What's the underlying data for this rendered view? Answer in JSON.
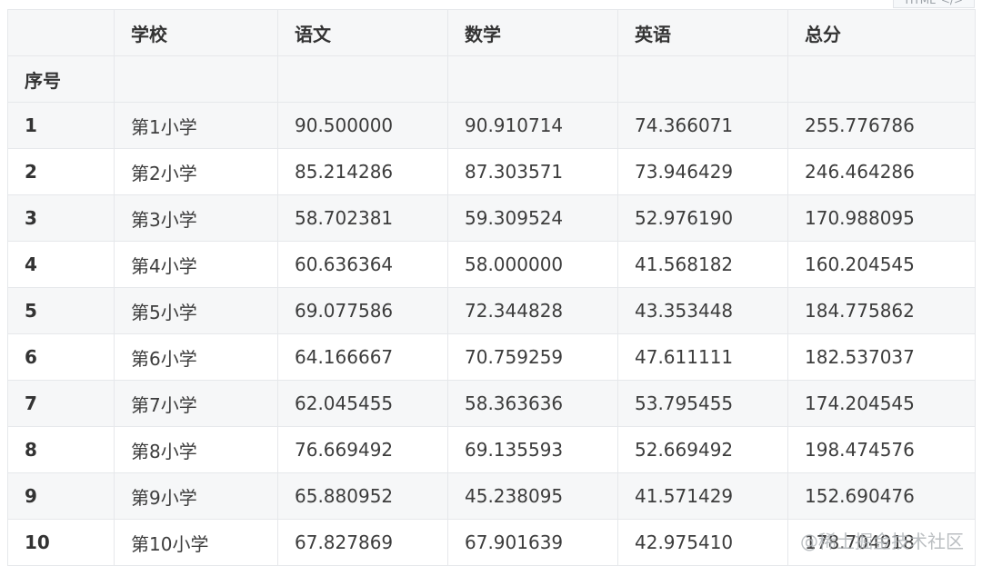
{
  "badge": {
    "text": "HTML",
    "icon": "code-icon"
  },
  "table": {
    "header": [
      "",
      "学校",
      "语文",
      "数学",
      "英语",
      "总分"
    ],
    "index_label": "序号",
    "rows": [
      {
        "idx": "1",
        "school": "第1小学",
        "chinese": "90.500000",
        "math": "90.910714",
        "english": "74.366071",
        "total": "255.776786"
      },
      {
        "idx": "2",
        "school": "第2小学",
        "chinese": "85.214286",
        "math": "87.303571",
        "english": "73.946429",
        "total": "246.464286"
      },
      {
        "idx": "3",
        "school": "第3小学",
        "chinese": "58.702381",
        "math": "59.309524",
        "english": "52.976190",
        "total": "170.988095"
      },
      {
        "idx": "4",
        "school": "第4小学",
        "chinese": "60.636364",
        "math": "58.000000",
        "english": "41.568182",
        "total": "160.204545"
      },
      {
        "idx": "5",
        "school": "第5小学",
        "chinese": "69.077586",
        "math": "72.344828",
        "english": "43.353448",
        "total": "184.775862"
      },
      {
        "idx": "6",
        "school": "第6小学",
        "chinese": "64.166667",
        "math": "70.759259",
        "english": "47.611111",
        "total": "182.537037"
      },
      {
        "idx": "7",
        "school": "第7小学",
        "chinese": "62.045455",
        "math": "58.363636",
        "english": "53.795455",
        "total": "174.204545"
      },
      {
        "idx": "8",
        "school": "第8小学",
        "chinese": "76.669492",
        "math": "69.135593",
        "english": "52.669492",
        "total": "198.474576"
      },
      {
        "idx": "9",
        "school": "第9小学",
        "chinese": "65.880952",
        "math": "45.238095",
        "english": "41.571429",
        "total": "152.690476"
      },
      {
        "idx": "10",
        "school": "第10小学",
        "chinese": "67.827869",
        "math": "67.901639",
        "english": "42.975410",
        "total": "178.704918"
      }
    ]
  },
  "watermark": "@稀土掘金技术社区"
}
